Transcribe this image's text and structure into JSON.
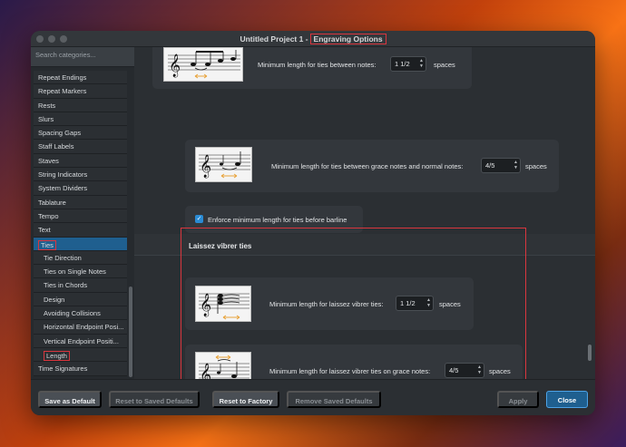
{
  "window": {
    "title_prefix": "Untitled Project 1 -",
    "title_highlight": "Engraving Options"
  },
  "sidebar": {
    "search_placeholder": "Search categories...",
    "items": [
      {
        "label": "Repeat Endings"
      },
      {
        "label": "Repeat Markers"
      },
      {
        "label": "Rests"
      },
      {
        "label": "Slurs"
      },
      {
        "label": "Spacing Gaps"
      },
      {
        "label": "Staff Labels"
      },
      {
        "label": "Staves"
      },
      {
        "label": "String Indicators"
      },
      {
        "label": "System Dividers"
      },
      {
        "label": "Tablature"
      },
      {
        "label": "Tempo"
      },
      {
        "label": "Text"
      },
      {
        "label": "Ties"
      },
      {
        "label": "Tie Direction"
      },
      {
        "label": "Ties on Single Notes"
      },
      {
        "label": "Ties in Chords"
      },
      {
        "label": "Design"
      },
      {
        "label": "Avoiding Collisions"
      },
      {
        "label": "Horizontal Endpoint Posi..."
      },
      {
        "label": "Vertical Endpoint Positi..."
      },
      {
        "label": "Length"
      },
      {
        "label": "Time Signatures"
      }
    ]
  },
  "options": {
    "ties_between_notes": {
      "label": "Minimum length for ties between notes:",
      "value": "1 1/2",
      "unit": "spaces"
    },
    "ties_grace_normal": {
      "label": "Minimum length for ties between grace notes and normal notes:",
      "value": "4/5",
      "unit": "spaces"
    },
    "enforce_barline": {
      "label": "Enforce minimum length for ties before barline",
      "checked": true
    },
    "section_title": "Laissez vibrer ties",
    "lv_ties": {
      "label": "Minimum length for laissez vibrer ties:",
      "value": "1 1/2",
      "unit": "spaces"
    },
    "lv_grace": {
      "label": "Minimum length for laissez vibrer ties on grace notes:",
      "value": "4/5",
      "unit": "spaces"
    }
  },
  "footer": {
    "save_default": "Save as Default",
    "reset_saved": "Reset to Saved Defaults",
    "reset_factory": "Reset to Factory",
    "remove_saved": "Remove Saved Defaults",
    "apply": "Apply",
    "close": "Close"
  },
  "colors": {
    "accent": "#1f5f8f",
    "highlight": "#d9363e",
    "tie_arrow": "#e8a43c"
  }
}
